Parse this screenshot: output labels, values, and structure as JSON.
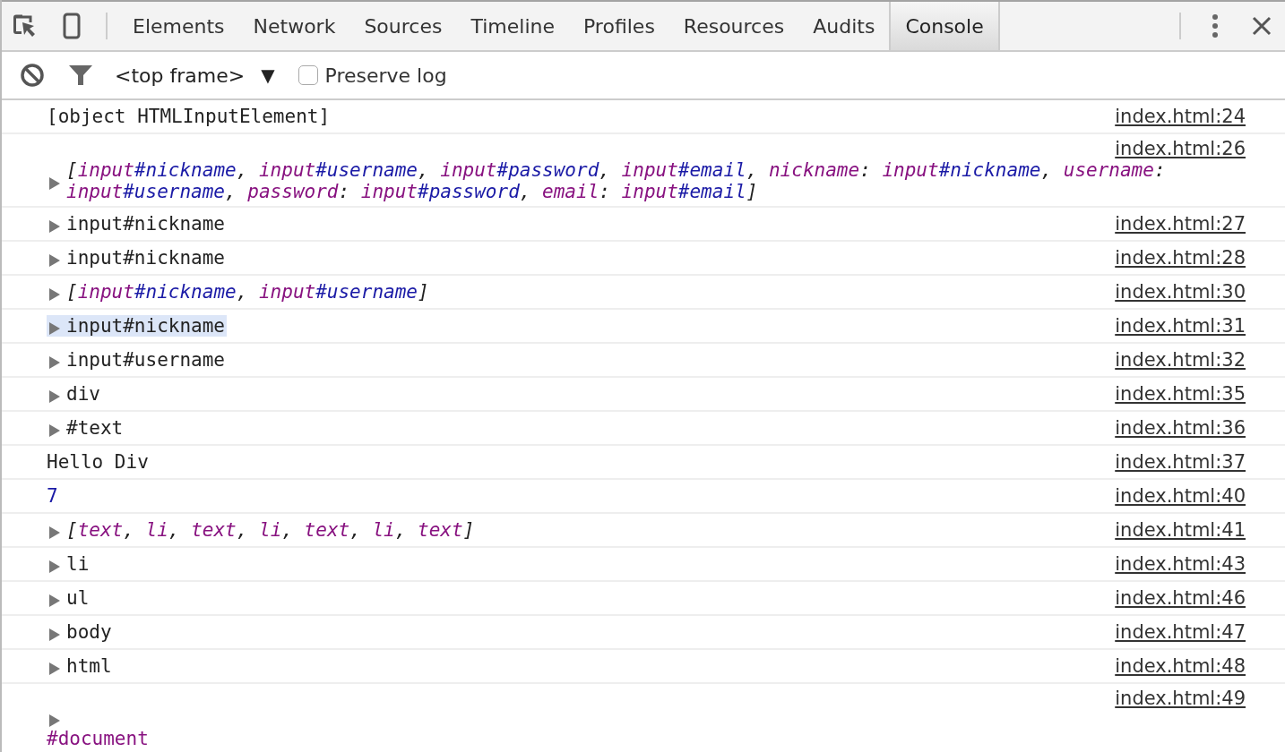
{
  "tabs": [
    {
      "label": "Elements",
      "selected": false
    },
    {
      "label": "Network",
      "selected": false
    },
    {
      "label": "Sources",
      "selected": false
    },
    {
      "label": "Timeline",
      "selected": false
    },
    {
      "label": "Profiles",
      "selected": false
    },
    {
      "label": "Resources",
      "selected": false
    },
    {
      "label": "Audits",
      "selected": false
    },
    {
      "label": "Console",
      "selected": true
    }
  ],
  "toolbar": {
    "frame_selector": "<top frame>",
    "dropdown_glyph": "▼",
    "preserve_log": {
      "label": "Preserve log",
      "checked": false
    }
  },
  "messages": [
    {
      "kind": "text",
      "expandable": false,
      "link_above": false,
      "selected": false,
      "text": "[object HTMLInputElement]",
      "source": "index.html:24"
    },
    {
      "kind": "array",
      "expandable": true,
      "link_above": true,
      "selected": false,
      "segments": [
        {
          "kind": "punct",
          "text": "["
        },
        {
          "kind": "tag",
          "text": "input"
        },
        {
          "kind": "id",
          "text": "#nickname"
        },
        {
          "kind": "punct",
          "text": ", "
        },
        {
          "kind": "tag",
          "text": "input"
        },
        {
          "kind": "id",
          "text": "#username"
        },
        {
          "kind": "punct",
          "text": ", "
        },
        {
          "kind": "tag",
          "text": "input"
        },
        {
          "kind": "id",
          "text": "#password"
        },
        {
          "kind": "punct",
          "text": ", "
        },
        {
          "kind": "tag",
          "text": "input"
        },
        {
          "kind": "id",
          "text": "#email"
        },
        {
          "kind": "punct",
          "text": ", "
        },
        {
          "kind": "key",
          "text": "nickname"
        },
        {
          "kind": "punct",
          "text": ": "
        },
        {
          "kind": "tag",
          "text": "input"
        },
        {
          "kind": "id",
          "text": "#nickname"
        },
        {
          "kind": "punct",
          "text": ", "
        },
        {
          "kind": "key",
          "text": "username"
        },
        {
          "kind": "punct",
          "text": ": "
        },
        {
          "kind": "tag",
          "text": "input"
        },
        {
          "kind": "id",
          "text": "#username"
        },
        {
          "kind": "punct",
          "text": ", "
        },
        {
          "kind": "key",
          "text": "password"
        },
        {
          "kind": "punct",
          "text": ": "
        },
        {
          "kind": "tag",
          "text": "input"
        },
        {
          "kind": "id",
          "text": "#password"
        },
        {
          "kind": "punct",
          "text": ", "
        },
        {
          "kind": "key",
          "text": "email"
        },
        {
          "kind": "punct",
          "text": ": "
        },
        {
          "kind": "tag",
          "text": "input"
        },
        {
          "kind": "id",
          "text": "#email"
        },
        {
          "kind": "punct",
          "text": "]"
        }
      ],
      "source": "index.html:26"
    },
    {
      "kind": "node",
      "expandable": true,
      "link_above": false,
      "selected": false,
      "text": "input#nickname",
      "source": "index.html:27"
    },
    {
      "kind": "node",
      "expandable": true,
      "link_above": false,
      "selected": false,
      "text": "input#nickname",
      "source": "index.html:28"
    },
    {
      "kind": "array",
      "expandable": true,
      "link_above": false,
      "selected": false,
      "segments": [
        {
          "kind": "punct",
          "text": "["
        },
        {
          "kind": "tag",
          "text": "input"
        },
        {
          "kind": "id",
          "text": "#nickname"
        },
        {
          "kind": "punct",
          "text": ", "
        },
        {
          "kind": "tag",
          "text": "input"
        },
        {
          "kind": "id",
          "text": "#username"
        },
        {
          "kind": "punct",
          "text": "]"
        }
      ],
      "source": "index.html:30"
    },
    {
      "kind": "node",
      "expandable": true,
      "link_above": false,
      "selected": true,
      "text": "input#nickname",
      "source": "index.html:31"
    },
    {
      "kind": "node",
      "expandable": true,
      "link_above": false,
      "selected": false,
      "text": "input#username",
      "source": "index.html:32"
    },
    {
      "kind": "node",
      "expandable": true,
      "link_above": false,
      "selected": false,
      "text": "div",
      "source": "index.html:35"
    },
    {
      "kind": "node",
      "expandable": true,
      "link_above": false,
      "selected": false,
      "text": "#text",
      "source": "index.html:36"
    },
    {
      "kind": "text",
      "expandable": false,
      "link_above": false,
      "selected": false,
      "text": "Hello Div",
      "source": "index.html:37"
    },
    {
      "kind": "number",
      "expandable": false,
      "link_above": false,
      "selected": false,
      "text": "7",
      "source": "index.html:40"
    },
    {
      "kind": "array",
      "expandable": true,
      "link_above": false,
      "selected": false,
      "segments": [
        {
          "kind": "punct",
          "text": "["
        },
        {
          "kind": "tag",
          "text": "text"
        },
        {
          "kind": "punct",
          "text": ", "
        },
        {
          "kind": "tag",
          "text": "li"
        },
        {
          "kind": "punct",
          "text": ", "
        },
        {
          "kind": "tag",
          "text": "text"
        },
        {
          "kind": "punct",
          "text": ", "
        },
        {
          "kind": "tag",
          "text": "li"
        },
        {
          "kind": "punct",
          "text": ", "
        },
        {
          "kind": "tag",
          "text": "text"
        },
        {
          "kind": "punct",
          "text": ", "
        },
        {
          "kind": "tag",
          "text": "li"
        },
        {
          "kind": "punct",
          "text": ", "
        },
        {
          "kind": "tag",
          "text": "text"
        },
        {
          "kind": "punct",
          "text": "]"
        }
      ],
      "source": "index.html:41"
    },
    {
      "kind": "node",
      "expandable": true,
      "link_above": false,
      "selected": false,
      "text": "li",
      "source": "index.html:43"
    },
    {
      "kind": "node",
      "expandable": true,
      "link_above": false,
      "selected": false,
      "text": "ul",
      "source": "index.html:46"
    },
    {
      "kind": "node",
      "expandable": true,
      "link_above": false,
      "selected": false,
      "text": "body",
      "source": "index.html:47"
    },
    {
      "kind": "node",
      "expandable": true,
      "link_above": false,
      "selected": false,
      "text": "html",
      "source": "index.html:48"
    },
    {
      "kind": "document",
      "expandable": true,
      "link_above": true,
      "selected": false,
      "text": "#document",
      "source": "index.html:49"
    }
  ]
}
